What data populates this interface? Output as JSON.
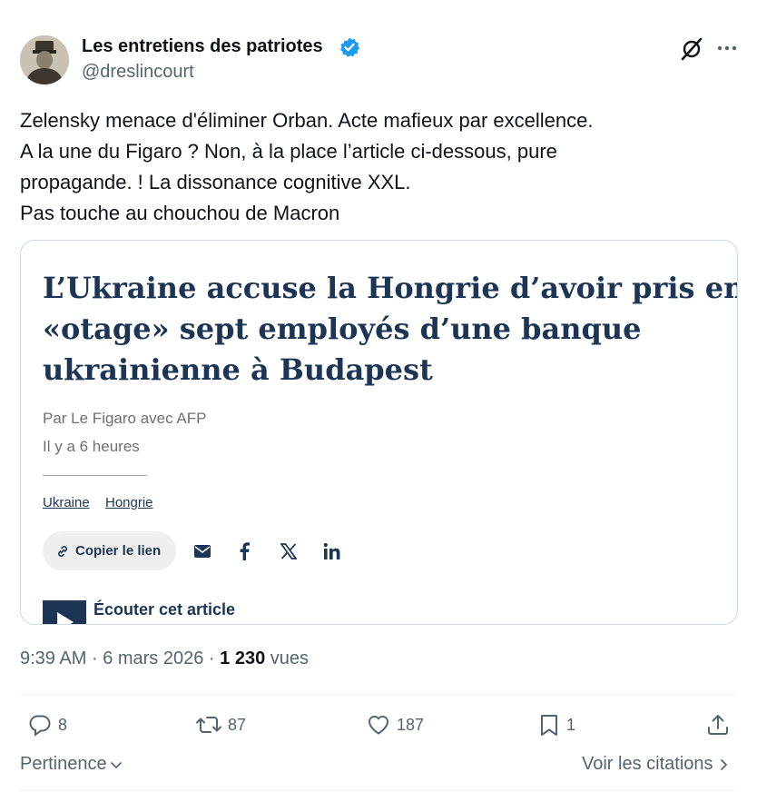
{
  "author": {
    "name": "Les entretiens des patriotes",
    "handle": "@dreslincourt",
    "avatar_icon": "soldier-portrait-avatar",
    "verified_icon": "verified-badge-icon",
    "verified_color": "#1d9bf0"
  },
  "tweet": {
    "lines": [
      "Zelensky menace d'éliminer Orban. Acte mafieux par excellence.",
      "A la une du Figaro ? Non, à la place l’article ci-dessous, pure",
      "propagande. ! La dissonance cognitive XXL.",
      "Pas touche au chouchou de Macron"
    ]
  },
  "card": {
    "headline_lines": [
      "L’Ukraine accuse la Hongrie d’avoir pris en",
      "«otage» sept employés d’une banque",
      "ukrainienne à Budapest"
    ],
    "byline": "Par Le Figaro avec AFP",
    "time_ago": "Il y a 6 heures",
    "tags": [
      "Ukraine",
      "Hongrie"
    ],
    "copy_link_label": "Copier le lien",
    "share_icons": [
      "mail-icon",
      "facebook-icon",
      "x-icon",
      "linkedin-icon"
    ],
    "listen_label": "Écouter cet article",
    "accent_color": "#1c3554"
  },
  "meta": {
    "time": "9:39 AM",
    "separator": "·",
    "date": "6 mars 2026",
    "views_count": "1 230",
    "views_label": "vues"
  },
  "actions": {
    "replies": "8",
    "reposts": "87",
    "likes": "187",
    "bookmarks": "1"
  },
  "footer": {
    "sort_label": "Pertinence",
    "quotes_label": "Voir les citations"
  }
}
